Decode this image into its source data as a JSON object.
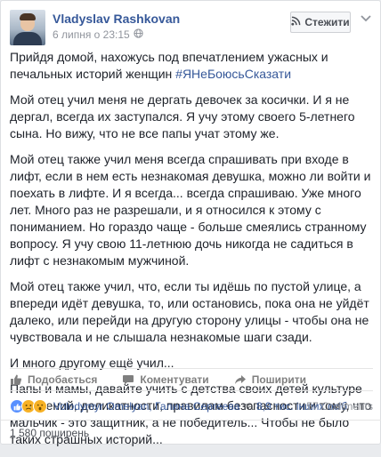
{
  "post": {
    "author": "Vladyslav Rashkovan",
    "timestamp": "6 липня о 23:15",
    "follow_label": "Стежити",
    "paragraphs": {
      "p1_text": "Прийдя домой, нахожусь под впечатлением ужасных и печальных историй женщин ",
      "p1_hashtag": "#ЯНеБоюсьСказати",
      "p2": "Мой отец учил меня не дергать девочек за косички. И я не дергал, всегда их заступался. Я учу этому своего 5-летнего сына. Но вижу, что не все папы учат этому же.",
      "p3": "Мой отец также учил меня всегда спрашивать при входе в лифт, если в нем есть незнакомая девушка, можно ли войти и поехать в лифте. И я всегда... всегда спрашиваю. Уже много лет. Много раз не разрешали, и я относился к этому с пониманием. Но гораздо чаще - больше смеялись странному вопросу. Я учу свою 11-летнюю дочь никогда не садиться в лифт с незнакомым мужчиной.",
      "p4": "Мой отец также учил, что, если ты идёшь по пустой улице, а впереди идёт девушка, то, или остановись, пока она не уйдёт далеко, или перейди на другую сторону улицы - чтобы она не чувствовала и не слышала незнакомые шаги сзади.",
      "p5": "И много другому ещё учил...",
      "p6": "Папы и мамы, давайте учить с детства своих детей культуре отношений, деликатности, правилам безопасности и тому, что мальчик - это защитник, а не победитель... Чтобы не было таких страшных историй..."
    }
  },
  "actions": {
    "like": "Подобається",
    "comment": "Коментувати",
    "share": "Поширити"
  },
  "reactions": {
    "names": "Volodymyr Omelyan, Галина Сергеева",
    "connector": " та ",
    "others": "8,9 тис. інших осіб",
    "comments_count": "57 Comments"
  },
  "shares": {
    "label": "1 580 поширень"
  },
  "icons": {
    "follow": "rss-icon",
    "menu": "chevron-down-icon",
    "privacy": "globe-icon",
    "like": "thumbs-up-icon",
    "comment": "comment-bubble-icon",
    "share": "share-arrow-icon"
  },
  "colors": {
    "link": "#365899",
    "text": "#1d2129",
    "muted": "#90949c",
    "like_reaction": "#5890ff",
    "emoji_reaction": "#f7b125"
  }
}
